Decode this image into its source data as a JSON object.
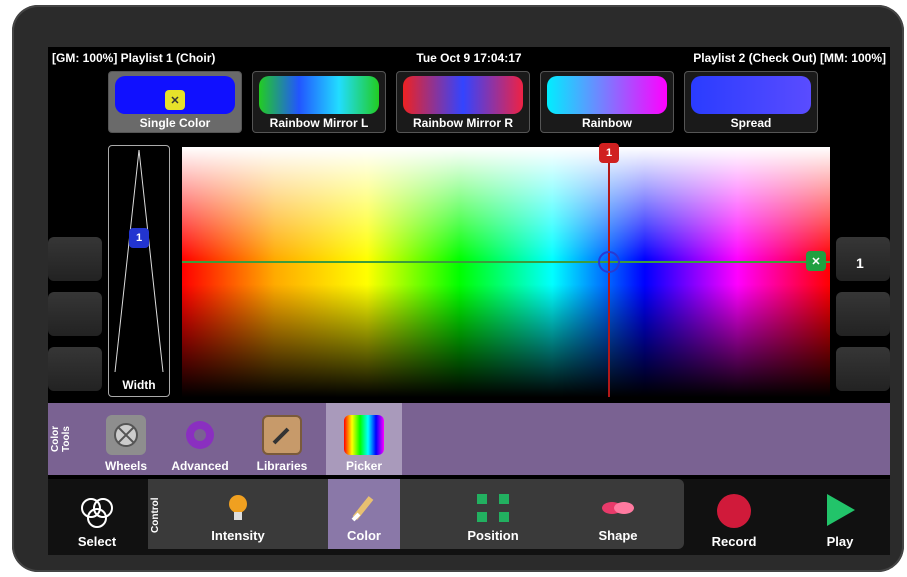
{
  "status": {
    "left": "[GM: 100%] Playlist 1 (Choir)",
    "center": "Tue Oct 9 17:04:17",
    "right": "Playlist 2 (Check Out) [MM: 100%]"
  },
  "presets": [
    {
      "label": "Single Color",
      "gradient": "linear-gradient(to right,#1010ff,#1010ff)",
      "active": true
    },
    {
      "label": "Rainbow Mirror L",
      "gradient": "linear-gradient(to right,#22cc22,#2255ff,#22ddff,#22cc22)",
      "active": false
    },
    {
      "label": "Rainbow Mirror R",
      "gradient": "linear-gradient(to right,#ee2222,#3344ff,#ee2244)",
      "active": false
    },
    {
      "label": "Rainbow",
      "gradient": "linear-gradient(to right,#00eeff,#ff00ff)",
      "active": false
    },
    {
      "label": "Spread",
      "gradient": "linear-gradient(to right,#2a3cff,#5a4cff)",
      "active": false
    }
  ],
  "width_label": "Width",
  "markers": {
    "width_marker": "1",
    "top_marker": "1"
  },
  "right_value": "1",
  "color_tools": {
    "side_label": "Color Tools",
    "tools": [
      {
        "label": "Wheels",
        "icon": "wheels-icon"
      },
      {
        "label": "Advanced",
        "icon": "gear-icon"
      },
      {
        "label": "Libraries",
        "icon": "brush-icon"
      },
      {
        "label": "Picker",
        "icon": "picker-icon",
        "active": true
      }
    ]
  },
  "bottom": {
    "select": "Select",
    "control_side": "Control",
    "controls": [
      {
        "label": "Intensity",
        "icon": "bulb-icon"
      },
      {
        "label": "Color",
        "icon": "brush-icon",
        "active": true
      },
      {
        "label": "Position",
        "icon": "position-icon"
      },
      {
        "label": "Shape",
        "icon": "shape-icon"
      }
    ],
    "record": "Record",
    "play": "Play"
  },
  "colors": {
    "tools_bar": "#7a6292",
    "active_control": "#8a78a8",
    "record": "#d01a3a",
    "play": "#22c46a"
  }
}
